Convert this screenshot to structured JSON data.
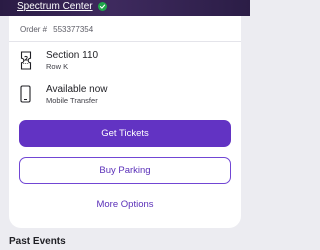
{
  "event": {
    "venue": "Spectrum Center"
  },
  "order": {
    "label": "Order #",
    "number": "553377354"
  },
  "seat": {
    "section": "Section 110",
    "row": "Row K"
  },
  "delivery": {
    "status": "Available now",
    "method": "Mobile Transfer"
  },
  "actions": {
    "get_tickets": "Get Tickets",
    "buy_parking": "Buy Parking",
    "more_options": "More Options"
  },
  "past_events": {
    "heading": "Past Events"
  },
  "colors": {
    "accent": "#6233c3",
    "badge": "#1fa64a",
    "hero": "#2a1b44"
  }
}
